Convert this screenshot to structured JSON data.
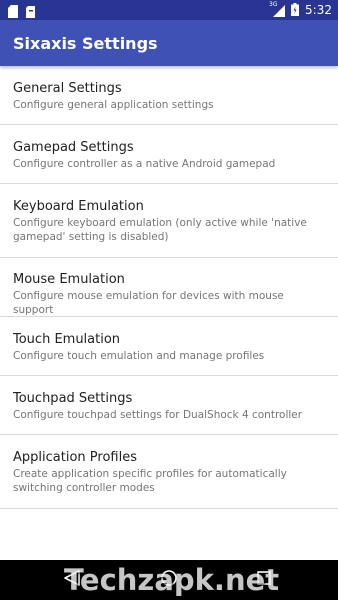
{
  "status_bar": {
    "network_label": "3G",
    "time": "5:32",
    "icons": [
      "sd-card-icon",
      "notification-icon",
      "signal-icon",
      "battery-icon"
    ]
  },
  "app_bar": {
    "title": "Sixaxis Settings"
  },
  "settings": [
    {
      "title": "General Settings",
      "summary": "Configure general application settings"
    },
    {
      "title": "Gamepad Settings",
      "summary": "Configure controller as a native Android gamepad"
    },
    {
      "title": "Keyboard Emulation",
      "summary": "Configure keyboard emulation (only active while 'native gamepad' setting is disabled)"
    },
    {
      "title": "Mouse Emulation",
      "summary": "Configure mouse emulation for devices with mouse support"
    },
    {
      "title": "Touch Emulation",
      "summary": "Configure touch emulation and manage profiles"
    },
    {
      "title": "Touchpad Settings",
      "summary": "Configure touchpad settings for DualShock 4 controller"
    },
    {
      "title": "Application Profiles",
      "summary": "Create application specific profiles for automatically switching controller modes"
    }
  ],
  "nav_bar": {
    "icons": [
      "back-icon",
      "home-icon",
      "recents-icon"
    ]
  },
  "watermark": "Techzapk.net",
  "colors": {
    "status_bar": "#283593",
    "app_bar": "#3f51b5",
    "title_text": "#212121",
    "summary_text": "#757575",
    "divider": "#d9d9d9"
  }
}
